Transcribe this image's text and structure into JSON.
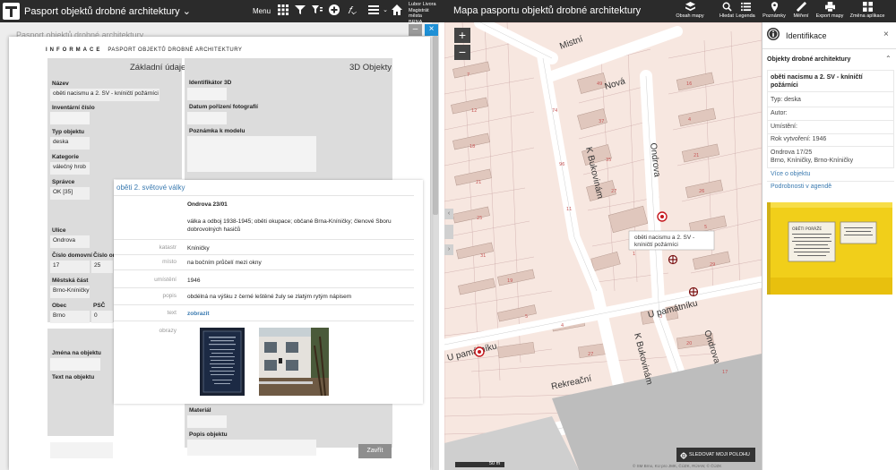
{
  "left_app": {
    "title": "Pasport objektů drobné architektury",
    "title_caret": "⌄",
    "menu_label": "Menu",
    "user_name": "Lubor Livora",
    "user_org": "Magistrát města",
    "user_city": "BRNA"
  },
  "right_app": {
    "title": "Mapa pasportu objektů drobné architektury",
    "toolbar": [
      {
        "label": "Obsah mapy",
        "icon": "layers-icon"
      },
      {
        "label": "Hledat",
        "icon": "search-icon"
      },
      {
        "label": "Legenda",
        "icon": "legend-icon"
      },
      {
        "label": "Poznámky",
        "icon": "pin-icon"
      },
      {
        "label": "Měření",
        "icon": "ruler-icon"
      },
      {
        "label": "Export mapy",
        "icon": "print-icon"
      },
      {
        "label": "Změna aplikace",
        "icon": "app-switch-icon"
      }
    ]
  },
  "form": {
    "background_title": "Pasport objektů drobné architektury",
    "header_caps": "INFORMACE",
    "header_rest": "PASPORT OBJEKTŮ DROBNÉ ARCHITEKTURY",
    "zakladni_title": "Základní údaje",
    "objekty3d_title": "3D Objekty",
    "nazev_label": "Název",
    "nazev_value": "oběti nacismu a 2. SV - kníničtí požárníci",
    "inventarni_label": "Inventární číslo",
    "typ_label": "Typ objektu",
    "typ_value": "deska",
    "kategorie_label": "Kategorie",
    "kategorie_value": "válečný hrob",
    "spravce_label": "Správce",
    "spravce_value": "OK [35]",
    "ulice_label": "Ulice",
    "ulice_value": "Ondrova",
    "cislo_dom_label": "Číslo domovní",
    "cislo_dom_value": "17",
    "cislo_or_label": "Číslo or",
    "cislo_or_value": "25",
    "mestska_label": "Městská část",
    "mestska_value": "Brno-Kníničky",
    "obec_label": "Obec",
    "obec_value": "Brno",
    "psc_label": "PSČ",
    "psc_value": "0",
    "jmena_label": "Jména na objektu",
    "text_label": "Text na objektu",
    "ident3d_label": "Identifikátor 3D",
    "datum_label": "Datum pořízení fotografií",
    "poznamka_label": "Poznámka k modelu",
    "material_label": "Materiál",
    "popis_label": "Popis objektu",
    "close_button": "Zavřít"
  },
  "detail": {
    "title": "oběti 2. světové války",
    "address": "Ondrova 23/01",
    "themes": "válka a odboj 1938-1945; oběti okupace; občané Brna-Kníničky; členové Sboru dobrovolných hasičů",
    "rows": [
      {
        "key": "katastr",
        "value": "Kníničky"
      },
      {
        "key": "místo",
        "value": "na bočním průčelí mezi okny"
      },
      {
        "key": "umístění",
        "value": "1946"
      },
      {
        "key": "popis",
        "value": "obdélná na výšku z černé leštěné žuly se zlatým rytým nápisem"
      },
      {
        "key": "text",
        "value": "zobrazit"
      },
      {
        "key": "obrazy",
        "value": ""
      }
    ]
  },
  "map": {
    "streets": [
      "Mistní",
      "Nová",
      "Ondrova",
      "K Bukovinám",
      "U památníku",
      "U památníku",
      "K Bukovinám",
      "Ondrova",
      "Rekreační"
    ],
    "popup_line1": "oběti nacismu a 2. SV -",
    "popup_line2": "kníničtí požárníci",
    "scale": "50 m",
    "follow_button": "SLEDOVAT MOJI POLOHU",
    "attribution": "© SM Brno, KU pro JMK, ČÚZK, RÚIAN; © ČÚZK"
  },
  "identify": {
    "title": "Identifikace",
    "group": "Objekty drobné architektury",
    "name": "oběti nacismu a 2. SV - kníničtí požárníci",
    "typ": "Typ: deska",
    "autor": "Autor:",
    "umisteni": "Umístění:",
    "rok": "Rok vytvoření: 1946",
    "adresa1": "Ondrova 17/25",
    "adresa2": "Brno, Kníničky, Brno-Kníničky",
    "link1": "Více o objektu",
    "link2": "Podrobnosti v agendě",
    "plaque_text": "OBĚTI PORÁŽE"
  },
  "colors": {
    "topbar": "#2b2b2b",
    "accent_blue": "#1e90d6",
    "link": "#3a7ab0",
    "marker_red": "#c4161c",
    "plaque_yellow": "#f1cf1a"
  }
}
